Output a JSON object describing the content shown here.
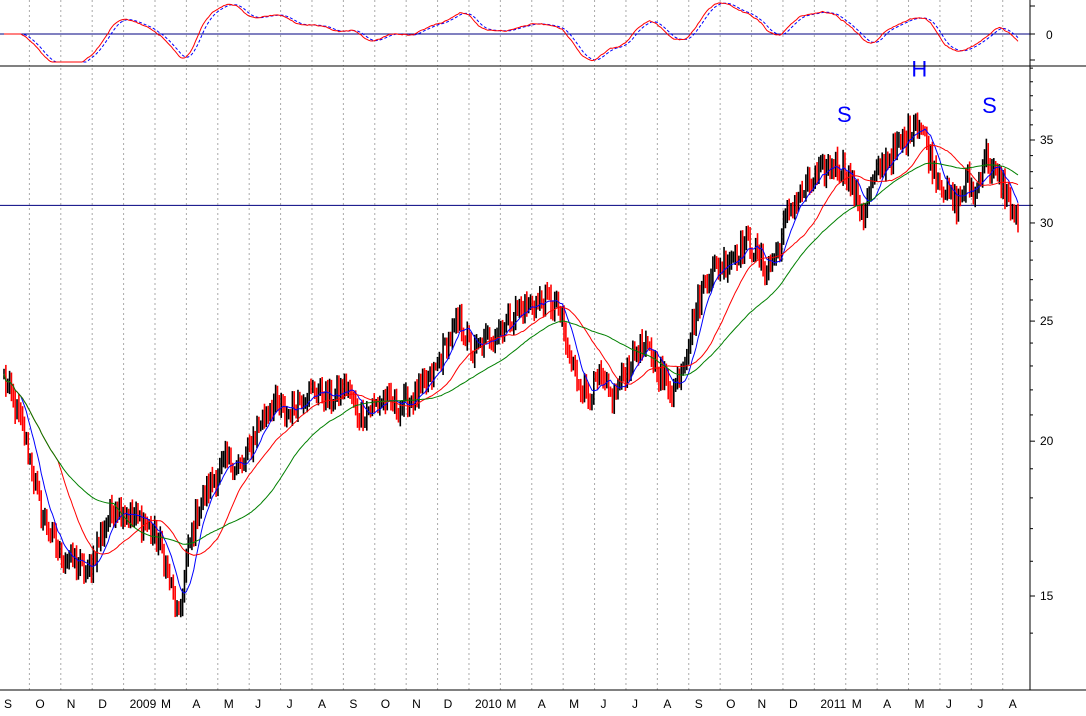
{
  "chart_data": {
    "type": "line",
    "title": "",
    "y_scale": "log",
    "ylim": [
      13.2,
      41
    ],
    "y_ticks": [
      15,
      20,
      25,
      30,
      35
    ],
    "grid": "vertical dotted lines at month boundaries",
    "x_tick_labels": [
      "S",
      "O",
      "N",
      "D",
      "2009",
      "M",
      "A",
      "M",
      "J",
      "J",
      "A",
      "S",
      "O",
      "N",
      "D",
      "2010",
      "M",
      "A",
      "M",
      "J",
      "J",
      "A",
      "S",
      "O",
      "N",
      "D",
      "2011",
      "M",
      "A",
      "M",
      "J",
      "J",
      "A"
    ],
    "neckline": 31.0,
    "pattern_labels": [
      "S",
      "H",
      "S"
    ],
    "price_anchors": [
      {
        "d": 0,
        "v": 22.5
      },
      {
        "d": 10,
        "v": 20.5
      },
      {
        "d": 20,
        "v": 17.5
      },
      {
        "d": 30,
        "v": 16.2
      },
      {
        "d": 38,
        "v": 16.0
      },
      {
        "d": 45,
        "v": 15.6
      },
      {
        "d": 52,
        "v": 16.8
      },
      {
        "d": 60,
        "v": 17.8
      },
      {
        "d": 68,
        "v": 17.4
      },
      {
        "d": 76,
        "v": 17.2
      },
      {
        "d": 84,
        "v": 16.5
      },
      {
        "d": 90,
        "v": 15.2
      },
      {
        "d": 94,
        "v": 14.3
      },
      {
        "d": 98,
        "v": 16.0
      },
      {
        "d": 104,
        "v": 17.6
      },
      {
        "d": 112,
        "v": 18.6
      },
      {
        "d": 120,
        "v": 19.3
      },
      {
        "d": 128,
        "v": 19.0
      },
      {
        "d": 136,
        "v": 20.5
      },
      {
        "d": 144,
        "v": 21.5
      },
      {
        "d": 152,
        "v": 21.0
      },
      {
        "d": 160,
        "v": 21.8
      },
      {
        "d": 168,
        "v": 22.0
      },
      {
        "d": 176,
        "v": 21.6
      },
      {
        "d": 184,
        "v": 22.2
      },
      {
        "d": 190,
        "v": 21.0
      },
      {
        "d": 196,
        "v": 21.2
      },
      {
        "d": 204,
        "v": 21.6
      },
      {
        "d": 212,
        "v": 21.3
      },
      {
        "d": 222,
        "v": 21.8
      },
      {
        "d": 230,
        "v": 22.5
      },
      {
        "d": 238,
        "v": 24.0
      },
      {
        "d": 245,
        "v": 25.0
      },
      {
        "d": 252,
        "v": 23.5
      },
      {
        "d": 260,
        "v": 24.2
      },
      {
        "d": 268,
        "v": 24.8
      },
      {
        "d": 276,
        "v": 25.5
      },
      {
        "d": 284,
        "v": 25.8
      },
      {
        "d": 292,
        "v": 26.0
      },
      {
        "d": 298,
        "v": 25.6
      },
      {
        "d": 303,
        "v": 23.5
      },
      {
        "d": 308,
        "v": 22.5
      },
      {
        "d": 314,
        "v": 21.8
      },
      {
        "d": 320,
        "v": 22.4
      },
      {
        "d": 327,
        "v": 21.6
      },
      {
        "d": 334,
        "v": 22.8
      },
      {
        "d": 341,
        "v": 23.8
      },
      {
        "d": 348,
        "v": 23.5
      },
      {
        "d": 354,
        "v": 22.5
      },
      {
        "d": 360,
        "v": 22.0
      },
      {
        "d": 366,
        "v": 23.5
      },
      {
        "d": 372,
        "v": 25.5
      },
      {
        "d": 378,
        "v": 27.3
      },
      {
        "d": 386,
        "v": 27.8
      },
      {
        "d": 394,
        "v": 28.5
      },
      {
        "d": 400,
        "v": 29.0
      },
      {
        "d": 405,
        "v": 28.2
      },
      {
        "d": 410,
        "v": 27.5
      },
      {
        "d": 416,
        "v": 28.5
      },
      {
        "d": 422,
        "v": 30.8
      },
      {
        "d": 430,
        "v": 31.8
      },
      {
        "d": 438,
        "v": 32.8
      },
      {
        "d": 446,
        "v": 33.5
      },
      {
        "d": 452,
        "v": 33.2
      },
      {
        "d": 458,
        "v": 31.5
      },
      {
        "d": 462,
        "v": 30.5
      },
      {
        "d": 466,
        "v": 32.0
      },
      {
        "d": 472,
        "v": 33.5
      },
      {
        "d": 478,
        "v": 34.2
      },
      {
        "d": 484,
        "v": 35.0
      },
      {
        "d": 490,
        "v": 36.5
      },
      {
        "d": 494,
        "v": 35.5
      },
      {
        "d": 498,
        "v": 33.8
      },
      {
        "d": 503,
        "v": 32.5
      },
      {
        "d": 508,
        "v": 31.5
      },
      {
        "d": 512,
        "v": 31.0
      },
      {
        "d": 518,
        "v": 32.5
      },
      {
        "d": 522,
        "v": 31.5
      },
      {
        "d": 527,
        "v": 34.2
      },
      {
        "d": 532,
        "v": 32.8
      },
      {
        "d": 537,
        "v": 32.2
      },
      {
        "d": 541,
        "v": 31.0
      },
      {
        "d": 545,
        "v": 29.8
      }
    ],
    "moving_averages": [
      {
        "color": "#0000ff",
        "period": 10
      },
      {
        "color": "#ff0000",
        "period": 30
      },
      {
        "color": "#008000",
        "period": 60
      }
    ],
    "oscillator": {
      "zero_label": "0",
      "solid_color": "#ff0000",
      "dashed_color": "#0000ff"
    }
  }
}
